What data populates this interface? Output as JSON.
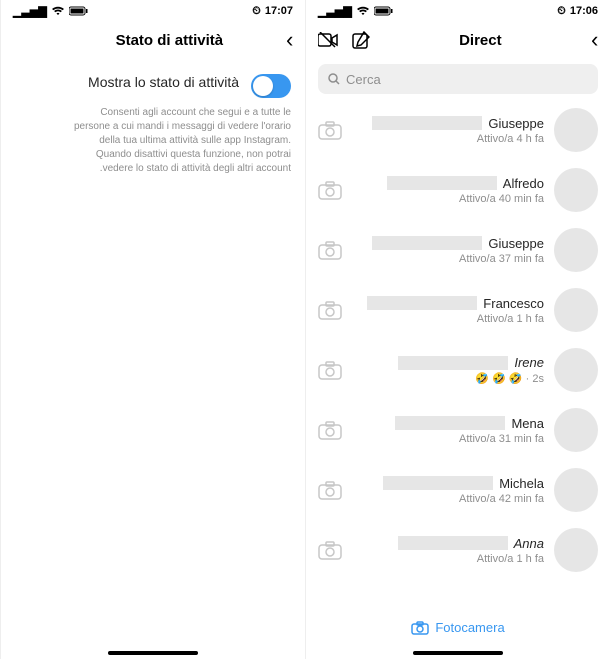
{
  "left_screen": {
    "status": {
      "time": "17:06",
      "alarm": "⏰",
      "signal": "▮▮▮▯",
      "wifi": "⬳",
      "battery": "▬"
    },
    "header": {
      "title": "Direct"
    },
    "search": {
      "placeholder": "Cerca"
    },
    "chats": [
      {
        "name": "Giuseppe",
        "status": "Attivo/a 4 h fa"
      },
      {
        "name": "Alfredo",
        "status": "Attivo/a 40 min fa"
      },
      {
        "name": "Giuseppe",
        "status": "Attivo/a 37 min fa"
      },
      {
        "name": "Francesco",
        "status": "Attivo/a 1 h fa"
      },
      {
        "name": "Irene",
        "status": "🤣 🤣 🤣 · 2s",
        "italic": true
      },
      {
        "name": "Mena",
        "status": "Attivo/a 31 min fa"
      },
      {
        "name": "Michela",
        "status": "Attivo/a 42 min fa"
      },
      {
        "name": "Anna",
        "status": "Attivo/a 1 h fa",
        "italic": true
      }
    ],
    "footer": {
      "camera_label": "Fotocamera"
    }
  },
  "right_screen": {
    "status": {
      "time": "17:07",
      "alarm": "⏰",
      "signal": "▮▮▮▯",
      "wifi": "⬳",
      "battery": "▬"
    },
    "header": {
      "title": "Stato di attività"
    },
    "setting": {
      "label": "Mostra lo stato di attività",
      "description": "Consenti agli account che segui e a tutte le persone a cui mandi i messaggi di vedere l'orario della tua ultima attività sulle app Instagram. Quando disattivi questa funzione, non potrai vedere lo stato di attività degli altri account."
    }
  }
}
